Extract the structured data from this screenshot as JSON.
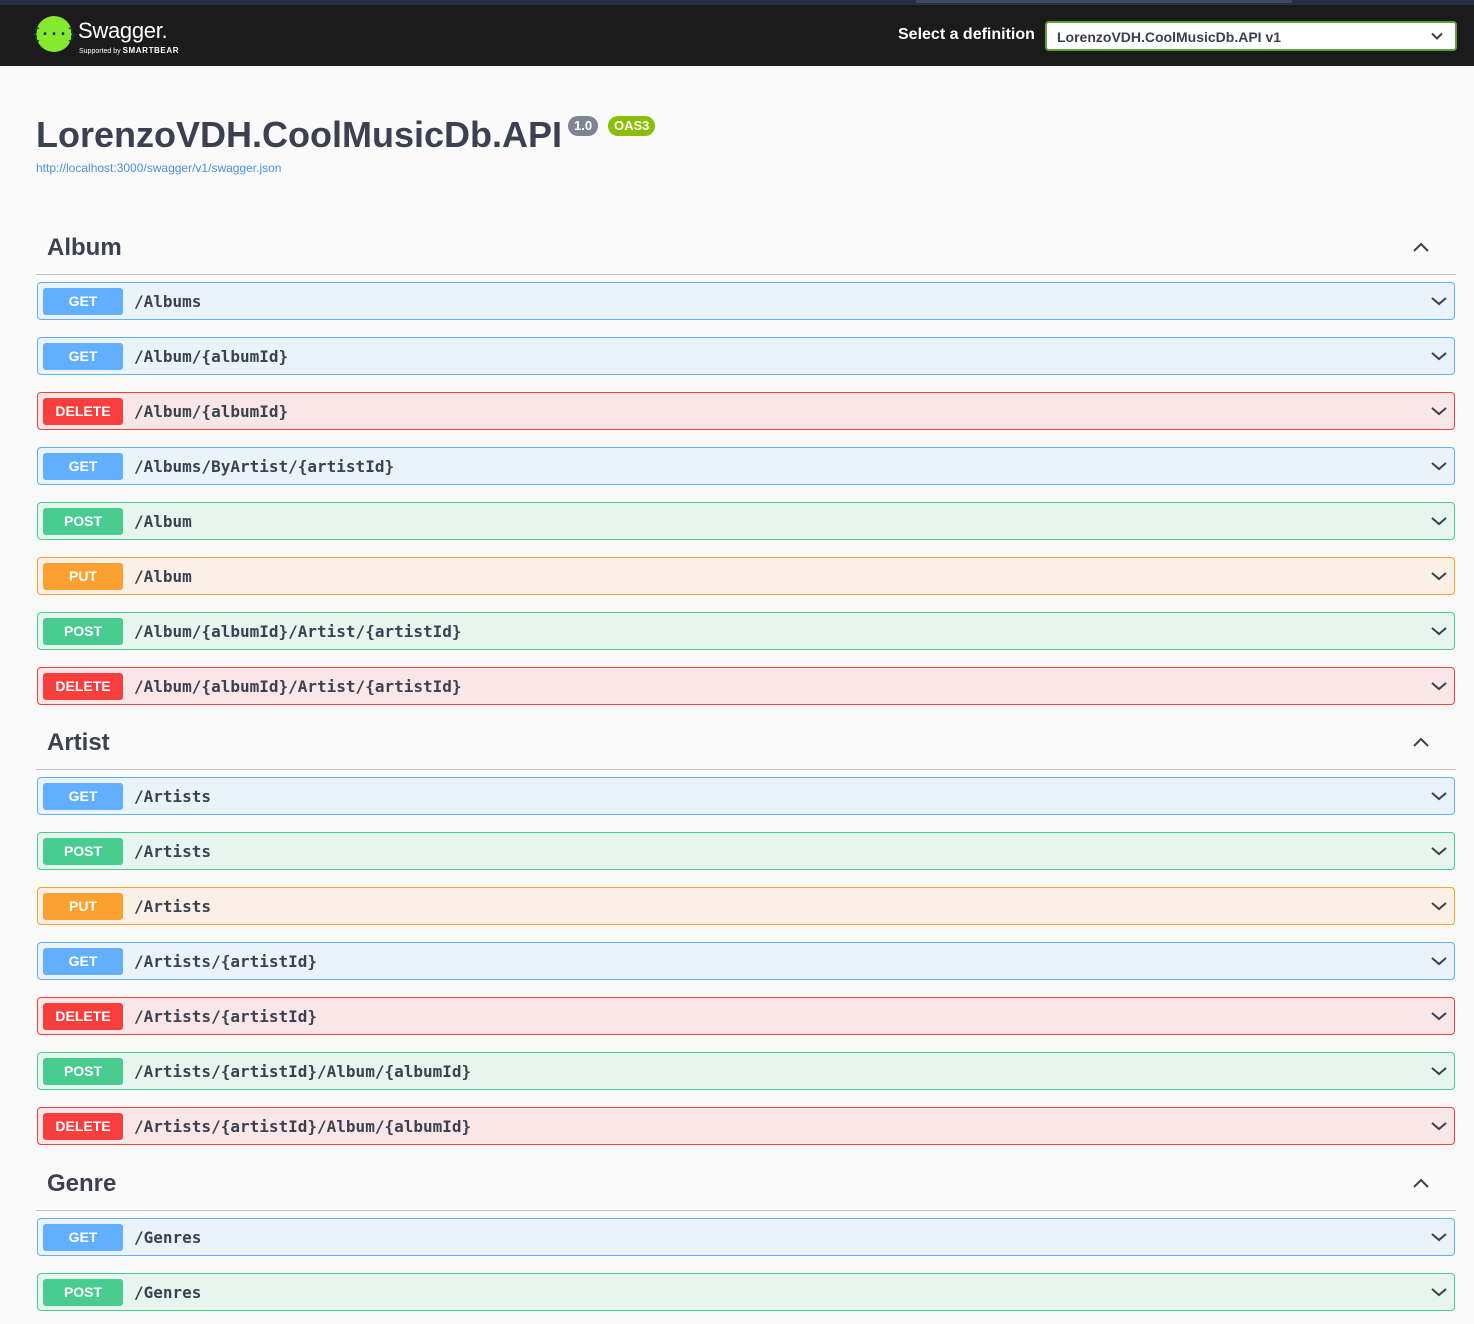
{
  "header": {
    "logo_glyph": "{···}",
    "logo_text": "Swagger.",
    "logo_supported": "Supported by",
    "logo_brand": "SMARTBEAR",
    "select_label": "Select a definition",
    "selected_definition": "LorenzoVDH.CoolMusicDb.API v1"
  },
  "info": {
    "title": "LorenzoVDH.CoolMusicDb.API",
    "version": "1.0",
    "oas": "OAS3",
    "url": "http://localhost:3000/swagger/v1/swagger.json"
  },
  "colors": {
    "get": "#61affe",
    "post": "#49cc90",
    "put": "#fca130",
    "delete": "#f93e3e",
    "topbar": "#1b1b1b",
    "logo_green": "#85ea2d"
  },
  "sections": [
    {
      "name": "Album",
      "operations": [
        {
          "method": "GET",
          "path": "/Albums"
        },
        {
          "method": "GET",
          "path": "/Album/{albumId}"
        },
        {
          "method": "DELETE",
          "path": "/Album/{albumId}"
        },
        {
          "method": "GET",
          "path": "/Albums/ByArtist/{artistId}"
        },
        {
          "method": "POST",
          "path": "/Album"
        },
        {
          "method": "PUT",
          "path": "/Album"
        },
        {
          "method": "POST",
          "path": "/Album/{albumId}/Artist/{artistId}"
        },
        {
          "method": "DELETE",
          "path": "/Album/{albumId}/Artist/{artistId}"
        }
      ]
    },
    {
      "name": "Artist",
      "operations": [
        {
          "method": "GET",
          "path": "/Artists"
        },
        {
          "method": "POST",
          "path": "/Artists"
        },
        {
          "method": "PUT",
          "path": "/Artists"
        },
        {
          "method": "GET",
          "path": "/Artists/{artistId}"
        },
        {
          "method": "DELETE",
          "path": "/Artists/{artistId}"
        },
        {
          "method": "POST",
          "path": "/Artists/{artistId}/Album/{albumId}"
        },
        {
          "method": "DELETE",
          "path": "/Artists/{artistId}/Album/{albumId}"
        }
      ]
    },
    {
      "name": "Genre",
      "operations": [
        {
          "method": "GET",
          "path": "/Genres"
        },
        {
          "method": "POST",
          "path": "/Genres"
        }
      ]
    }
  ]
}
